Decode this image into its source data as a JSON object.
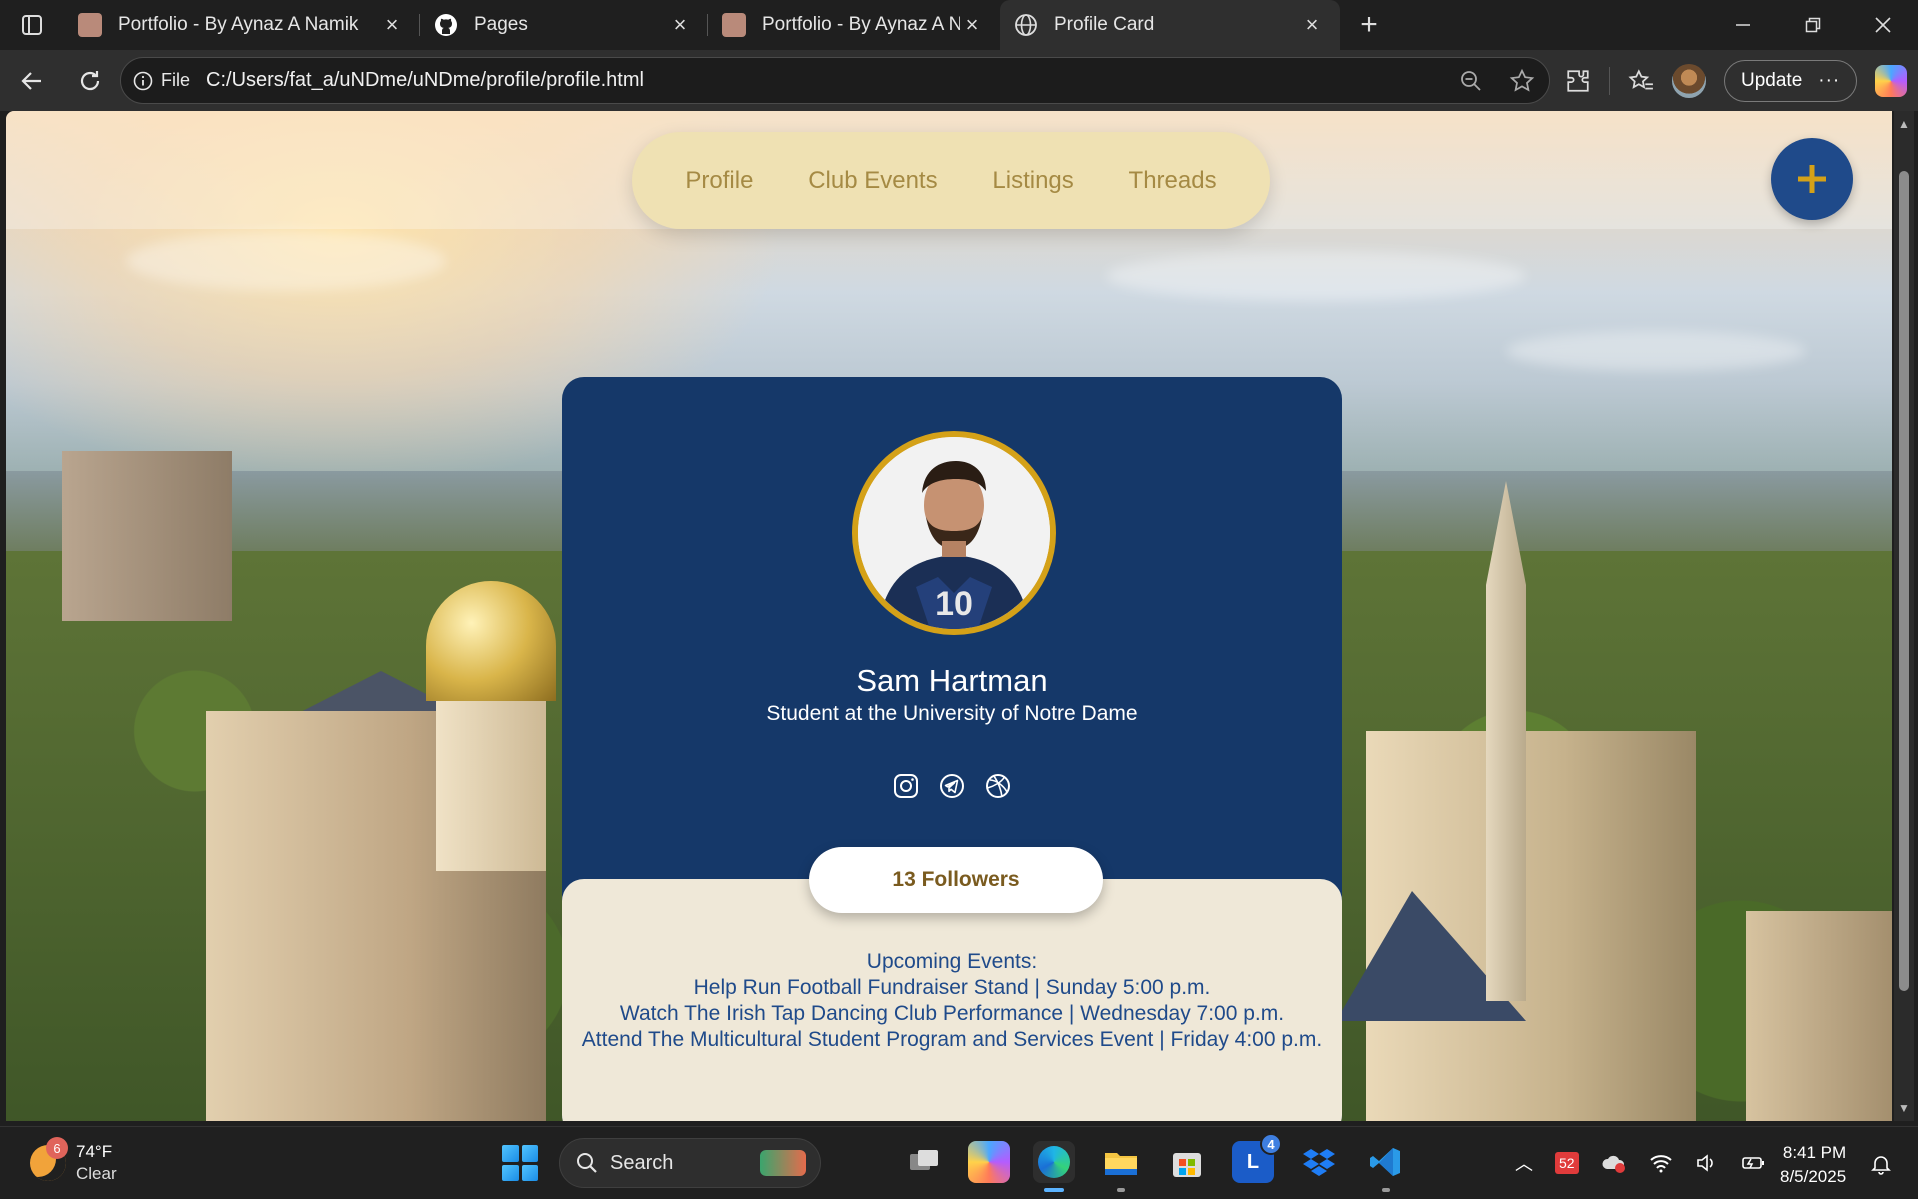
{
  "browser": {
    "tabs": [
      {
        "title": "Portfolio - By Aynaz A Namik",
        "active": false
      },
      {
        "title": "Pages",
        "active": false
      },
      {
        "title": "Portfolio - By Aynaz A Namik",
        "active": false
      },
      {
        "title": "Profile Card",
        "active": true
      }
    ],
    "url_scheme_label": "File",
    "url": "C:/Users/fat_a/uNDme/uNDme/profile/profile.html",
    "update_label": "Update"
  },
  "page": {
    "nav": [
      "Profile",
      "Club Events",
      "Listings",
      "Threads"
    ],
    "fab_label": "+",
    "profile": {
      "name": "Sam Hartman",
      "subtitle": "Student at the University of Notre Dame",
      "socials": [
        "instagram-icon",
        "telegram-icon",
        "dribbble-icon"
      ],
      "followers": "13 Followers",
      "events_heading": "Upcoming Events:",
      "events": [
        "Help Run Football Fundraiser Stand | Sunday 5:00 p.m.",
        "Watch The Irish Tap Dancing Club Performance | Wednesday 7:00 p.m.",
        "Attend The Multicultural Student Program and Services Event | Friday 4:00 p.m."
      ]
    },
    "colors": {
      "card_navy": "#153869",
      "card_cream": "#efe8d8",
      "nav_pill": "#efe1b3",
      "gold": "#d4a118",
      "fab_blue": "#1f4a8a"
    }
  },
  "taskbar": {
    "weather_badge": "6",
    "temperature": "74°F",
    "condition": "Clear",
    "search_placeholder": "Search",
    "linkedin_badge": "4",
    "tray_badge": "52",
    "time": "8:41 PM",
    "date": "8/5/2025"
  }
}
